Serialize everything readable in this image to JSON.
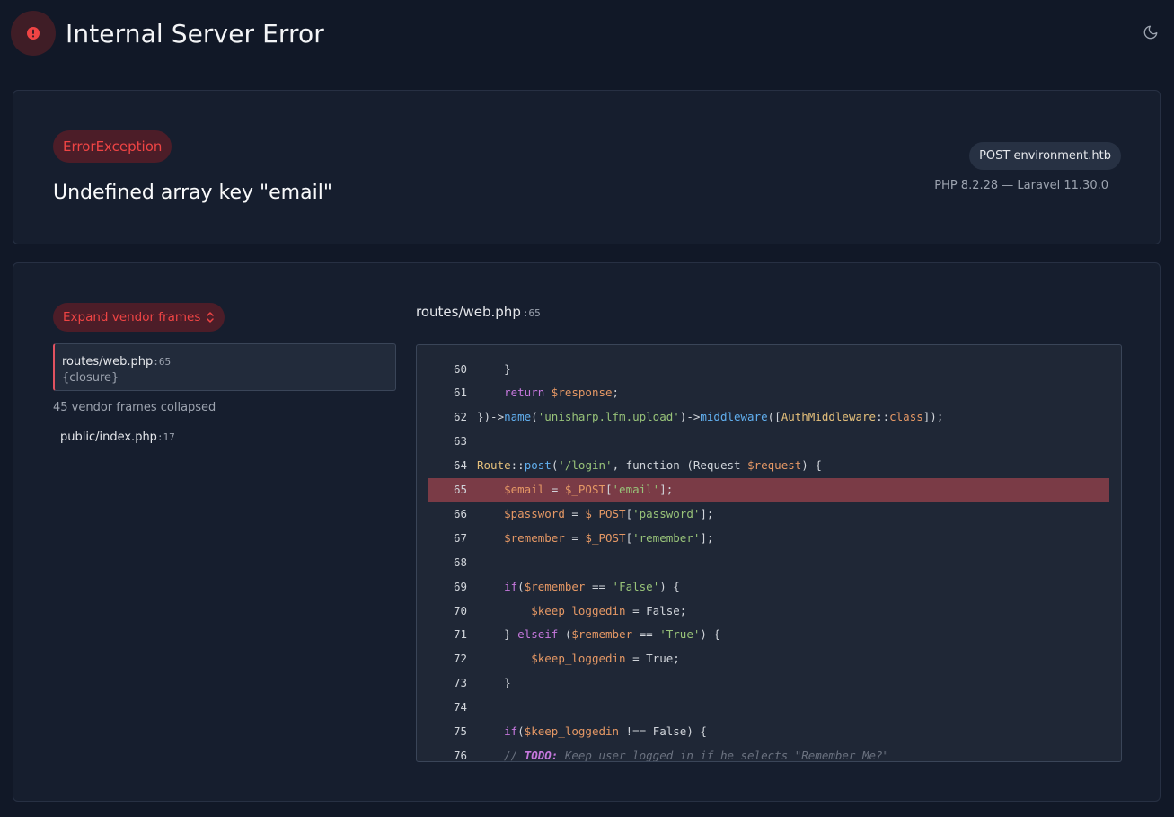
{
  "header": {
    "title": "Internal Server Error",
    "icon": "alert-circle-icon",
    "theme_icon": "moon-icon"
  },
  "exception": {
    "class": "ErrorException",
    "message": "Undefined array key \"email\"",
    "request": "POST environment.htb",
    "versions": "PHP 8.2.28 — Laravel 11.30.0"
  },
  "frames": {
    "expand_label": "Expand vendor frames",
    "active": {
      "file": "routes/web.php",
      "line": ":65",
      "function": "{closure}"
    },
    "collapsed_note": "45 vendor frames collapsed",
    "other": {
      "file": "public/index.php",
      "line": ":17"
    }
  },
  "code": {
    "file": "routes/web.php",
    "line": ":65",
    "highlight_line": 65,
    "lines": [
      {
        "n": "60",
        "tokens": [
          [
            "p",
            "    }"
          ]
        ]
      },
      {
        "n": "61",
        "tokens": [
          [
            "p",
            "    "
          ],
          [
            "kw",
            "return"
          ],
          [
            "p",
            " "
          ],
          [
            "var",
            "$response"
          ],
          [
            "p",
            ";"
          ]
        ]
      },
      {
        "n": "62",
        "tokens": [
          [
            "p",
            "})->"
          ],
          [
            "fn",
            "name"
          ],
          [
            "p",
            "("
          ],
          [
            "str",
            "'unisharp.lfm.upload'"
          ],
          [
            "p",
            ")->"
          ],
          [
            "fn",
            "middleware"
          ],
          [
            "p",
            "(["
          ],
          [
            "cls",
            "AuthMiddleware"
          ],
          [
            "p",
            "::"
          ],
          [
            "var",
            "class"
          ],
          [
            "p",
            "]);"
          ]
        ]
      },
      {
        "n": "63",
        "tokens": []
      },
      {
        "n": "64",
        "tokens": [
          [
            "cls",
            "Route"
          ],
          [
            "p",
            "::"
          ],
          [
            "fn",
            "post"
          ],
          [
            "p",
            "("
          ],
          [
            "str",
            "'/login'"
          ],
          [
            "p",
            ", function (Request "
          ],
          [
            "var",
            "$request"
          ],
          [
            "p",
            ") {"
          ]
        ]
      },
      {
        "n": "65",
        "tokens": [
          [
            "p",
            "    "
          ],
          [
            "var",
            "$email"
          ],
          [
            "p",
            " = "
          ],
          [
            "var",
            "$_POST"
          ],
          [
            "p",
            "["
          ],
          [
            "str",
            "'email'"
          ],
          [
            "p",
            "];"
          ]
        ]
      },
      {
        "n": "66",
        "tokens": [
          [
            "p",
            "    "
          ],
          [
            "var",
            "$password"
          ],
          [
            "p",
            " = "
          ],
          [
            "var",
            "$_POST"
          ],
          [
            "p",
            "["
          ],
          [
            "str",
            "'password'"
          ],
          [
            "p",
            "];"
          ]
        ]
      },
      {
        "n": "67",
        "tokens": [
          [
            "p",
            "    "
          ],
          [
            "var",
            "$remember"
          ],
          [
            "p",
            " = "
          ],
          [
            "var",
            "$_POST"
          ],
          [
            "p",
            "["
          ],
          [
            "str",
            "'remember'"
          ],
          [
            "p",
            "];"
          ]
        ]
      },
      {
        "n": "68",
        "tokens": []
      },
      {
        "n": "69",
        "tokens": [
          [
            "p",
            "    "
          ],
          [
            "kw",
            "if"
          ],
          [
            "p",
            "("
          ],
          [
            "var",
            "$remember"
          ],
          [
            "p",
            " == "
          ],
          [
            "str",
            "'False'"
          ],
          [
            "p",
            ") {"
          ]
        ]
      },
      {
        "n": "70",
        "tokens": [
          [
            "p",
            "        "
          ],
          [
            "var",
            "$keep_loggedin"
          ],
          [
            "p",
            " = False;"
          ]
        ]
      },
      {
        "n": "71",
        "tokens": [
          [
            "p",
            "    } "
          ],
          [
            "kw",
            "elseif"
          ],
          [
            "p",
            " ("
          ],
          [
            "var",
            "$remember"
          ],
          [
            "p",
            " == "
          ],
          [
            "str",
            "'True'"
          ],
          [
            "p",
            ") {"
          ]
        ]
      },
      {
        "n": "72",
        "tokens": [
          [
            "p",
            "        "
          ],
          [
            "var",
            "$keep_loggedin"
          ],
          [
            "p",
            " = True;"
          ]
        ]
      },
      {
        "n": "73",
        "tokens": [
          [
            "p",
            "    }"
          ]
        ]
      },
      {
        "n": "74",
        "tokens": []
      },
      {
        "n": "75",
        "tokens": [
          [
            "p",
            "    "
          ],
          [
            "kw",
            "if"
          ],
          [
            "p",
            "("
          ],
          [
            "var",
            "$keep_loggedin"
          ],
          [
            "p",
            " !== False) {"
          ]
        ]
      },
      {
        "n": "76",
        "tokens": [
          [
            "p",
            "    "
          ],
          [
            "cmt",
            "// "
          ],
          [
            "todo",
            "TODO:"
          ],
          [
            "cmt",
            " Keep user logged in if he selects \"Remember Me?\""
          ]
        ]
      }
    ]
  }
}
